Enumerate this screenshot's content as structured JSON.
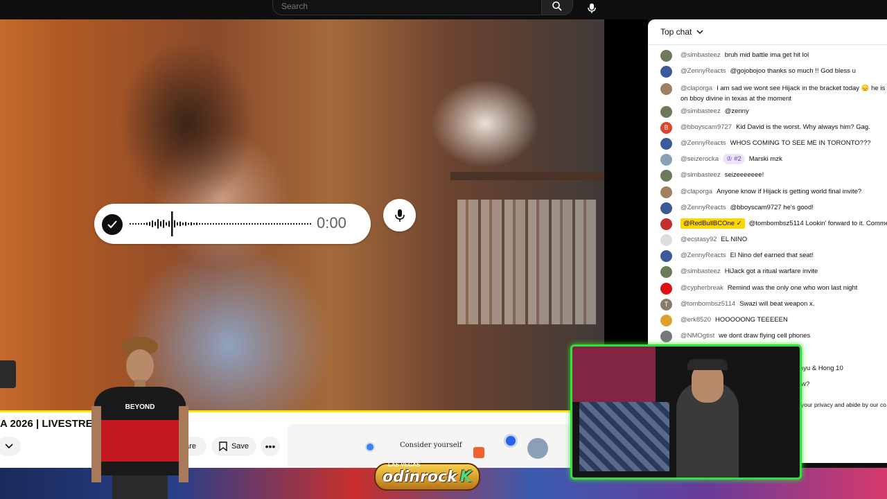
{
  "header": {
    "search_placeholder": "Search"
  },
  "recorder": {
    "time": "0:00"
  },
  "chat": {
    "title": "Top chat",
    "messages": [
      {
        "user": "@simbasteez",
        "text": "bruh mid battle ima get hit lol",
        "avatar": "#6b7a5a"
      },
      {
        "user": "@ZennyReacts",
        "text": "@gojobojoo thanks so much !! God bless u",
        "avatar": "#3a5a9a"
      },
      {
        "user": "@claporga",
        "text": "I am sad we wont see Hijack in the bracket today 😞 he is",
        "text2": "on bboy divine in texas at the moment",
        "avatar": "#a08060"
      },
      {
        "user": "@simbasteez",
        "text": "@zenny",
        "avatar": "#6b7a5a"
      },
      {
        "user": "@bboyscam9727",
        "text": "Kid David is the worst. Why always him? Gag.",
        "avatar": "#e0442e",
        "initial": "B"
      },
      {
        "user": "@ZennyReacts",
        "text": "WHOS COMING TO SEE ME IN TORONTO???",
        "avatar": "#3a5a9a"
      },
      {
        "user": "@seizerocka",
        "text": "Marski mzk",
        "rank": "♔ #2",
        "avatar": "#8aa0b8"
      },
      {
        "user": "@simbasteez",
        "text": "seizeeeeeee!",
        "avatar": "#6b7a5a"
      },
      {
        "user": "@claporga",
        "text": "Anyone know if Hijack is getting world final invite?",
        "avatar": "#a08060"
      },
      {
        "user": "@ZennyReacts",
        "text": "@bboyscam9727 he's good!",
        "avatar": "#3a5a9a"
      },
      {
        "user": "@RedBullBCOne ✓",
        "text": "@tombombsz5114 Lookin' forward to it. Commen",
        "badge": true,
        "avatar": "#c03030"
      },
      {
        "user": "@ecstasy92",
        "text": "EL NINO",
        "avatar": "#dddddd"
      },
      {
        "user": "@ZennyReacts",
        "text": "El Nino def earned that seat!",
        "avatar": "#3a5a9a"
      },
      {
        "user": "@simbasteez",
        "text": "HiJack got a ritual warfare invite",
        "avatar": "#6b7a5a"
      },
      {
        "user": "@cypherbreak",
        "text": "Remind was the only one who won last night",
        "avatar": "#e01010"
      },
      {
        "user": "@tombombsz5114",
        "text": "Swazi will beat weapon x.",
        "avatar": "#8a7a6a",
        "initial": "T"
      },
      {
        "user": "@erk8520",
        "text": "HOOOOONG TEEEEEN",
        "avatar": "#e0a030"
      },
      {
        "user": "@NMOgtist",
        "text": "we dont draw flying cell phones",
        "avatar": "#777777"
      }
    ],
    "partial_1": "Ayu & Hong 10",
    "partial_2": "ow?",
    "partial_3": "d your privacy and abide by our co"
  },
  "video_info": {
    "title": "A 2026 | LIVESTREAM",
    "share_label": "hare",
    "save_label": "Save"
  },
  "ad": {
    "text": "Consider yourself"
  },
  "overlay": {
    "logo_text": "odinrock",
    "logo_k": "K",
    "logo_sub": "LAS VEGAS"
  },
  "person": {
    "shirt_text": "BEYOND"
  },
  "colors": {
    "accent_yellow": "#ffe600",
    "webcam_frame": "#34e03a",
    "badge_yellow": "#ffd600"
  }
}
